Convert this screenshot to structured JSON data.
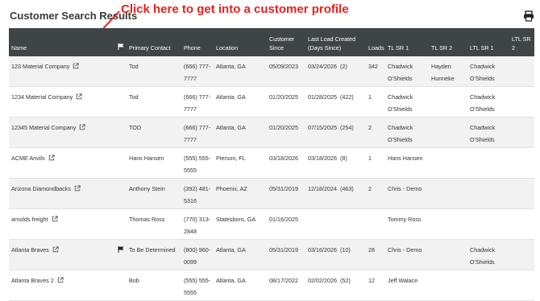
{
  "page": {
    "title": "Customer Search Results",
    "annotation": "Click here to get into a customer profile"
  },
  "columns": {
    "name": "Name",
    "primary_contact": "Primary Contact",
    "phone": "Phone",
    "location": "Location",
    "customer_since": "Customer Since",
    "last_load": "Last Load Created (Days Since)",
    "loads": "Loads",
    "tl_sr1": "TL SR 1",
    "tl_sr2": "TL SR 2",
    "ltl_sr1": "LTL SR 1",
    "ltl_sr2": "LTL SR 2"
  },
  "icons": {
    "flag_header": "flag-icon",
    "external_link": "external-link-icon",
    "print": "print-icon"
  },
  "rows": [
    {
      "name": "123 Material Company",
      "flag": false,
      "contact": "Tod",
      "phone": "(666) 777-7777",
      "location": "Atlanta, GA",
      "since": "05/09/2023",
      "last_load": "03/24/2026",
      "days": "(2)",
      "loads": "342",
      "tl1": "Chadwick O'Shields",
      "tl2": "Hayden Hunneke",
      "ltl1": "Chadwick O'Shields",
      "ltl2": ""
    },
    {
      "name": "1234 Material Company",
      "flag": false,
      "contact": "Tod",
      "phone": "(666) 777-7777",
      "location": "Atlanta, GA",
      "since": "01/20/2025",
      "last_load": "01/28/2025",
      "days": "(422)",
      "loads": "1",
      "tl1": "Chadwick O'Shields",
      "tl2": "",
      "ltl1": "Chadwick O'Shields",
      "ltl2": ""
    },
    {
      "name": "12345 Material Company",
      "flag": false,
      "contact": "TOD",
      "phone": "(666) 777-7777",
      "location": "Atlanta, GA",
      "since": "01/20/2025",
      "last_load": "07/15/2025",
      "days": "(254)",
      "loads": "2",
      "tl1": "Chadwick O'Shields",
      "tl2": "",
      "ltl1": "Chadwick O'Shields",
      "ltl2": ""
    },
    {
      "name": "ACME Anvils",
      "flag": false,
      "contact": "Hans Hansen",
      "phone": "(555) 555-5555",
      "location": "Pierson, FL",
      "since": "03/18/2026",
      "last_load": "03/18/2026",
      "days": "(8)",
      "loads": "1",
      "tl1": "Hans Hansen",
      "tl2": "",
      "ltl1": "",
      "ltl2": ""
    },
    {
      "name": "Arizona Diamondbacks",
      "flag": false,
      "contact": "Anthony Stein",
      "phone": "(392) 481-5316",
      "location": "Phoenix, AZ",
      "since": "05/31/2019",
      "last_load": "12/18/2024",
      "days": "(463)",
      "loads": "2",
      "tl1": "Chris - Demo",
      "tl2": "",
      "ltl1": "",
      "ltl2": ""
    },
    {
      "name": "arnolds freight",
      "flag": false,
      "contact": "Thomas Ross",
      "phone": "(770) 313-2848",
      "location": "Statesboro, GA",
      "since": "01/16/2025",
      "last_load": "",
      "days": "",
      "loads": "",
      "tl1": "Tommy Ross",
      "tl2": "",
      "ltl1": "",
      "ltl2": ""
    },
    {
      "name": "Atlanta Braves",
      "flag": true,
      "contact": "To Be Determined",
      "phone": "(800) 960-0099",
      "location": "Atlanta, GA",
      "since": "05/31/2019",
      "last_load": "03/16/2026",
      "days": "(10)",
      "loads": "28",
      "tl1": "Chris - Demo",
      "tl2": "",
      "ltl1": "Chadwick O'Shields",
      "ltl2": ""
    },
    {
      "name": "Atlanta Braves 2",
      "flag": false,
      "contact": "Bob",
      "phone": "(555) 555-5555",
      "location": "Atlanta, GA",
      "since": "08/17/2022",
      "last_load": "02/02/2026",
      "days": "(52)",
      "loads": "12",
      "tl1": "Jeff Walace",
      "tl2": "",
      "ltl1": "",
      "ltl2": ""
    }
  ]
}
